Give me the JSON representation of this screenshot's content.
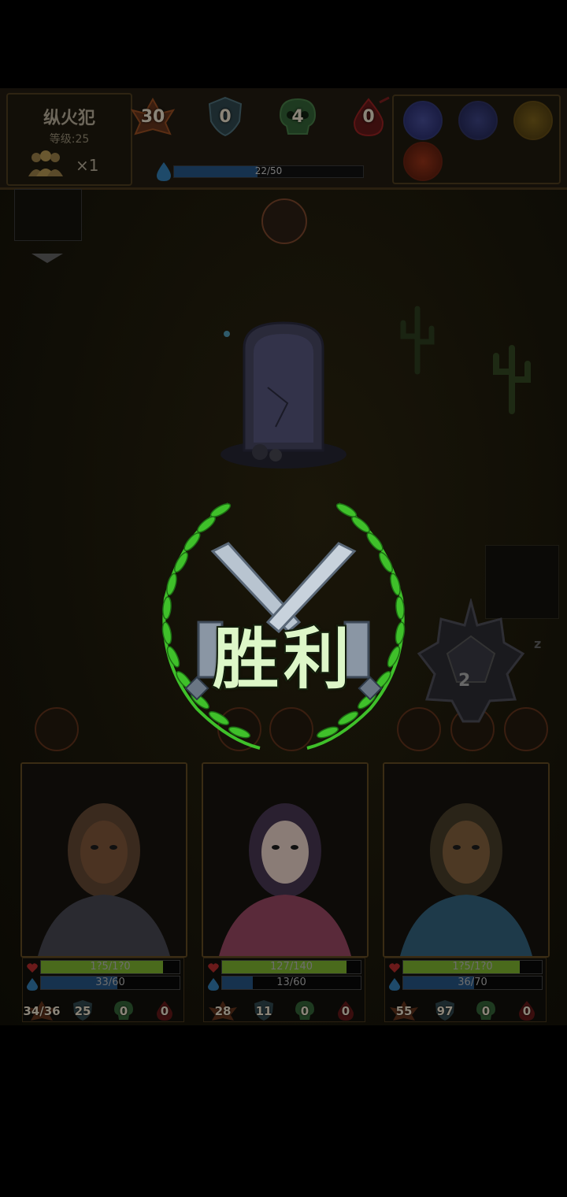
{
  "enemy": {
    "name": "纵火犯",
    "level": "等级:25",
    "party_count": "×1",
    "stats": {
      "attack": "30",
      "armor": "0",
      "poison": "4",
      "bleed": "0"
    },
    "mana": {
      "current": 22,
      "max": 50,
      "text": "22/50"
    }
  },
  "enemy_skills": [
    "swirl-rune-icon",
    "blue-crystal-icon",
    "golden-claw-icon",
    "fire-orb-icon"
  ],
  "banner": {
    "text": "胜利"
  },
  "dice": {
    "value": "2",
    "sleep": "z"
  },
  "heroes": [
    {
      "name": "warrior",
      "hp_text": "1?5/1?0",
      "hp_fraction": 0.88,
      "mana_text": "33/60",
      "mana_fraction": 0.55,
      "attack": "34/36",
      "armor": "25",
      "poison": "0",
      "bleed": "0"
    },
    {
      "name": "nun",
      "hp_text": "127/140",
      "hp_fraction": 0.9,
      "mana_text": "13/60",
      "mana_fraction": 0.22,
      "attack": "28",
      "armor": "11",
      "poison": "0",
      "bleed": "0"
    },
    {
      "name": "shaman",
      "hp_text": "1?5/1?0",
      "hp_fraction": 0.84,
      "mana_text": "36/70",
      "mana_fraction": 0.51,
      "attack": "55",
      "armor": "97",
      "poison": "0",
      "bleed": "0"
    }
  ],
  "colors": {
    "hp": "#4a6a1c",
    "mana": "#16324e",
    "victory_text": "#ddf7c8",
    "laurel": "#3fc02a"
  }
}
